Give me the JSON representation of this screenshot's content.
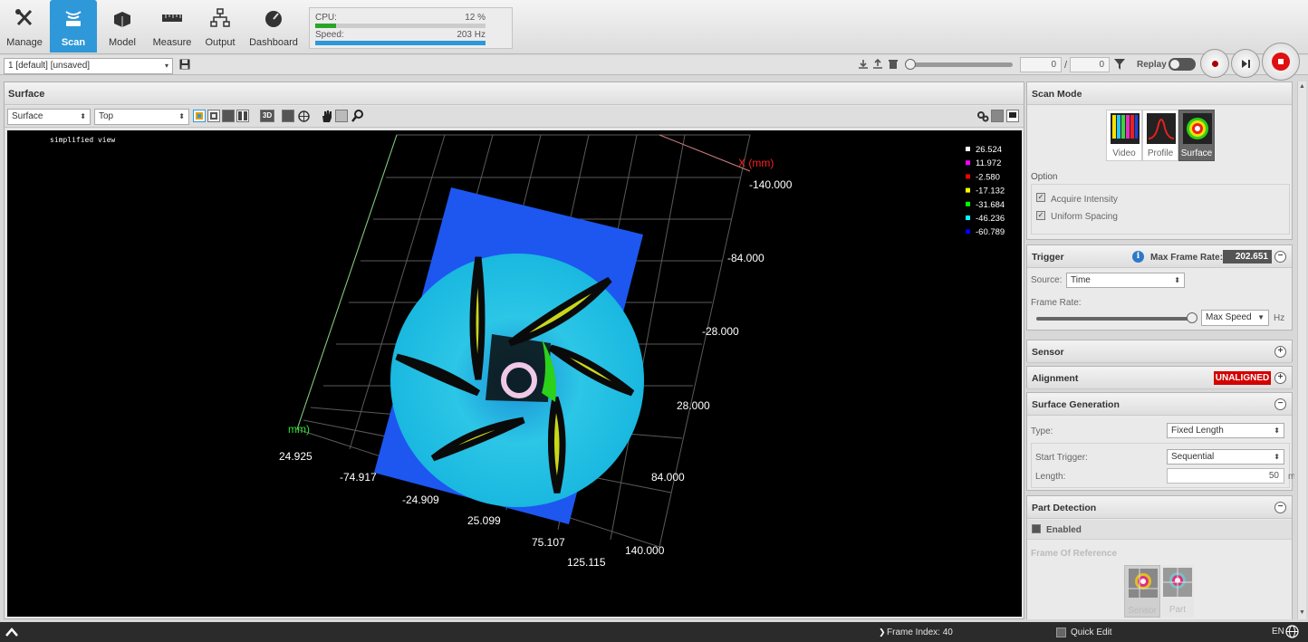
{
  "nav": {
    "items": [
      {
        "label": "Manage",
        "icon": "tools-icon"
      },
      {
        "label": "Scan",
        "icon": "scan-icon"
      },
      {
        "label": "Model",
        "icon": "cubes-icon"
      },
      {
        "label": "Measure",
        "icon": "ruler-icon"
      },
      {
        "label": "Output",
        "icon": "network-icon"
      },
      {
        "label": "Dashboard",
        "icon": "gauge-icon"
      }
    ],
    "active": "Scan"
  },
  "perf": {
    "cpu_label": "CPU:",
    "cpu_value": "12 %",
    "cpu_fraction": 0.12,
    "speed_label": "Speed:",
    "speed_value": "203 Hz",
    "speed_fraction": 1.0
  },
  "job": {
    "selected": "1 [default] [unsaved]"
  },
  "replay": {
    "frame_start": "0",
    "separator": "/",
    "frame_end": "0",
    "label": "Replay"
  },
  "surface": {
    "title": "Surface",
    "view_select": "Surface",
    "orient_select": "Top",
    "mode_3d": "3D",
    "overlay_text": "simplified view",
    "legend": [
      {
        "value": "26.524",
        "color": "#ffffff"
      },
      {
        "value": "11.972",
        "color": "#ff00ff"
      },
      {
        "value": "-2.580",
        "color": "#ff0000"
      },
      {
        "value": "-17.132",
        "color": "#ffff00"
      },
      {
        "value": "-31.684",
        "color": "#00ff00"
      },
      {
        "value": "-46.236",
        "color": "#00ffff"
      },
      {
        "value": "-60.789",
        "color": "#0000ff"
      }
    ],
    "x_axis_label": "X (mm)",
    "y_axis_label": "mm)",
    "x_ticks": [
      "-140.000",
      "-84.000",
      "-28.000",
      "28.000",
      "84.000",
      "140.000"
    ],
    "y_ticks": [
      "24.925",
      "-74.917",
      "-24.909",
      "25.099",
      "75.107",
      "125.115"
    ]
  },
  "scan_mode": {
    "title": "Scan Mode",
    "modes": [
      "Video",
      "Profile",
      "Surface"
    ],
    "active": "Surface",
    "option_title": "Option",
    "options": [
      {
        "label": "Acquire Intensity",
        "checked": true
      },
      {
        "label": "Uniform Spacing",
        "checked": true
      }
    ]
  },
  "trigger": {
    "title": "Trigger",
    "max_frame_rate_label": "Max Frame Rate:",
    "max_frame_rate_value": "202.651",
    "source_label": "Source:",
    "source_value": "Time",
    "frame_rate_label": "Frame Rate:",
    "frame_rate_select": "Max Speed",
    "unit": "Hz"
  },
  "sensor": {
    "title": "Sensor"
  },
  "alignment": {
    "title": "Alignment",
    "status": "UNALIGNED",
    "status_color": "#d40000"
  },
  "surface_generation": {
    "title": "Surface Generation",
    "type_label": "Type:",
    "type_value": "Fixed Length",
    "start_trigger_label": "Start Trigger:",
    "start_trigger_value": "Sequential",
    "length_label": "Length:",
    "length_value": "50",
    "length_unit": "mm"
  },
  "part_detection": {
    "title": "Part Detection",
    "enabled_label": "Enabled",
    "frame_of_reference_label": "Frame Of Reference",
    "frames": [
      "Sensor",
      "Part"
    ]
  },
  "status_bar": {
    "frame_index": "Frame Index: 40",
    "quick_edit": "Quick Edit",
    "language": "EN"
  },
  "colors": {
    "accent": "#2e98d8",
    "alert": "#d40000"
  }
}
